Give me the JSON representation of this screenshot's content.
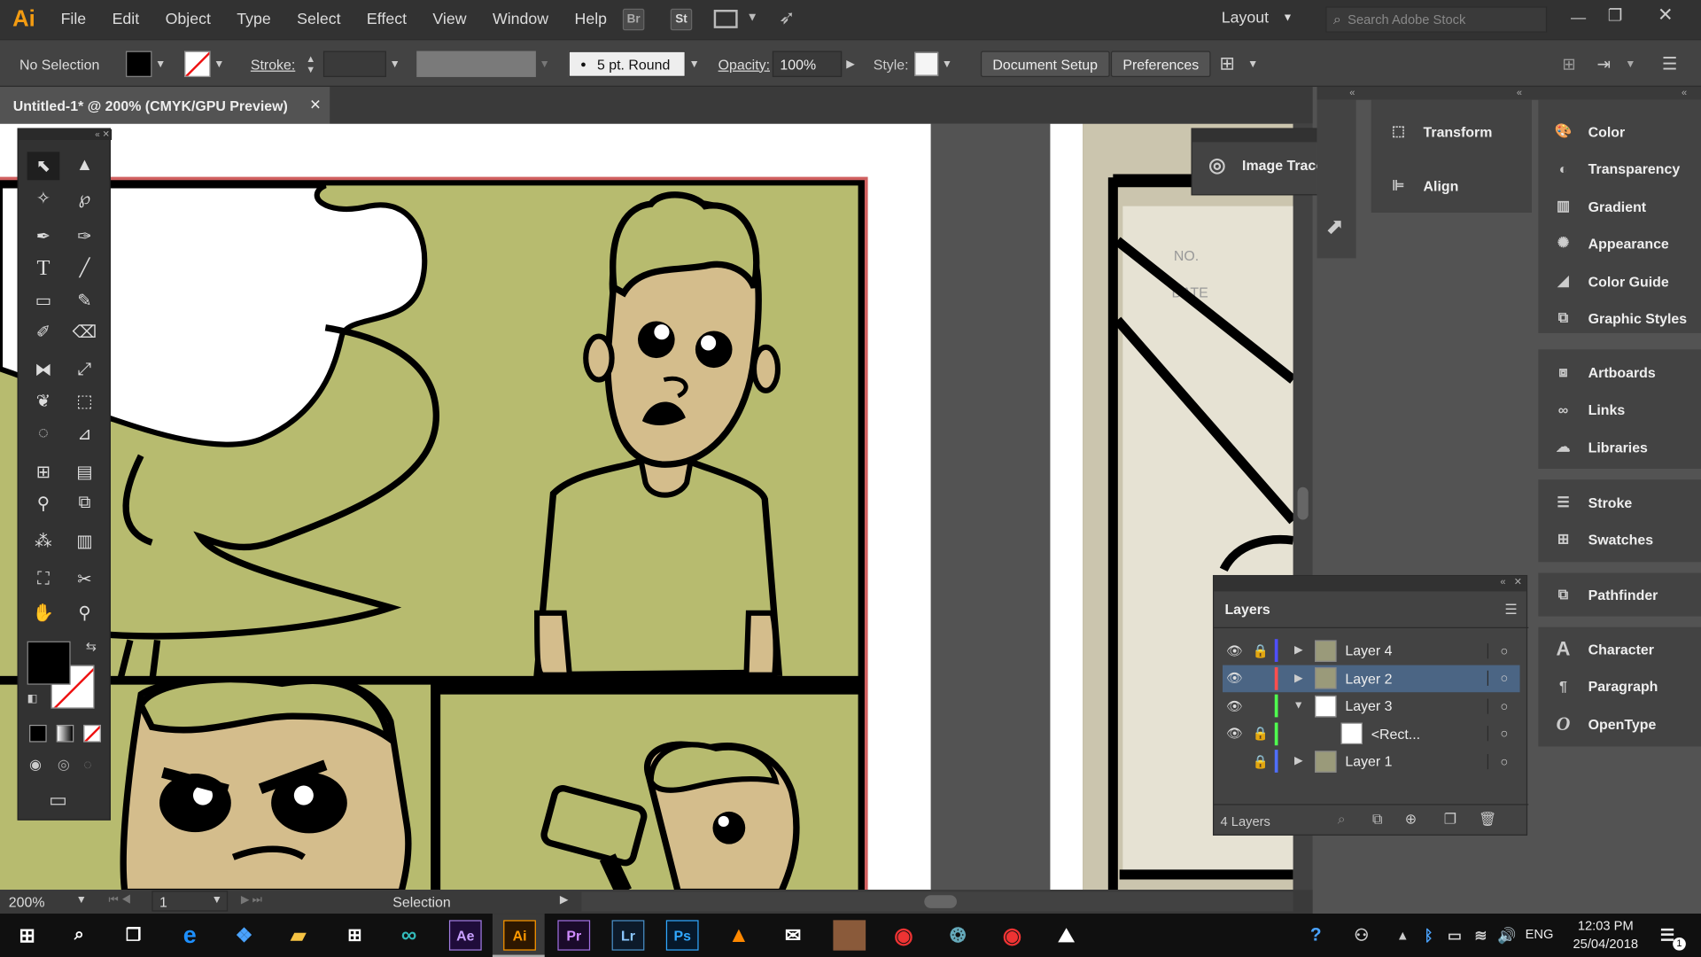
{
  "app": {
    "logo": "Ai",
    "menus": [
      "File",
      "Edit",
      "Object",
      "Type",
      "Select",
      "Effect",
      "View",
      "Window",
      "Help"
    ],
    "bridge": "Br",
    "stock": "St",
    "workspace": "Layout",
    "search_placeholder": "Search Adobe Stock"
  },
  "options": {
    "selection": "No Selection",
    "stroke_label": "Stroke:",
    "brush": "5 pt. Round",
    "opacity_label": "Opacity:",
    "opacity": "100%",
    "style_label": "Style:",
    "doc_setup": "Document Setup",
    "preferences": "Preferences"
  },
  "document": {
    "tab_title": "Untitled-1* @ 200% (CMYK/GPU Preview)",
    "close": "✕"
  },
  "status": {
    "zoom": "200%",
    "page": "1",
    "tool": "Selection"
  },
  "floating": {
    "image_trace": "Image Trace"
  },
  "panels": {
    "col1": [
      "Transform",
      "Align"
    ],
    "col2a": [
      "Color",
      "Transparency",
      "Gradient",
      "Appearance",
      "Color Guide",
      "Graphic Styles"
    ],
    "col2b": [
      "Artboards",
      "Links",
      "Libraries"
    ],
    "col2c": [
      "Stroke",
      "Swatches"
    ],
    "col2d": [
      "Pathfinder"
    ],
    "col2e": [
      "Character",
      "Paragraph",
      "OpenType"
    ]
  },
  "layers": {
    "title": "Layers",
    "rows": [
      {
        "name": "Layer 4",
        "color": "#4f4fff",
        "locked": true,
        "visible": true,
        "expanded": false,
        "selected": false
      },
      {
        "name": "Layer 2",
        "color": "#ff4f4f",
        "locked": false,
        "visible": true,
        "expanded": false,
        "selected": true
      },
      {
        "name": "Layer 3",
        "color": "#4fff4f",
        "locked": false,
        "visible": true,
        "expanded": true,
        "selected": false
      },
      {
        "name": "<Rect...",
        "color": "#4fff4f",
        "locked": true,
        "visible": true,
        "expanded": false,
        "selected": false
      },
      {
        "name": "Layer 1",
        "color": "#4f6fff",
        "locked": true,
        "visible": false,
        "expanded": false,
        "selected": false
      }
    ],
    "count": "4 Layers"
  },
  "taskbar": {
    "time": "12:03 PM",
    "date": "25/04/2018",
    "lang": "ENG",
    "apps": [
      "Ae",
      "Ai",
      "Pr",
      "Lr",
      "Ps"
    ],
    "notif": "1"
  },
  "colors": {
    "panel_bg": "#535353",
    "menubar": "#323232",
    "olive": "#b7bb6f",
    "skin": "#d4bd8c",
    "ai_orange": "#f39c12"
  }
}
